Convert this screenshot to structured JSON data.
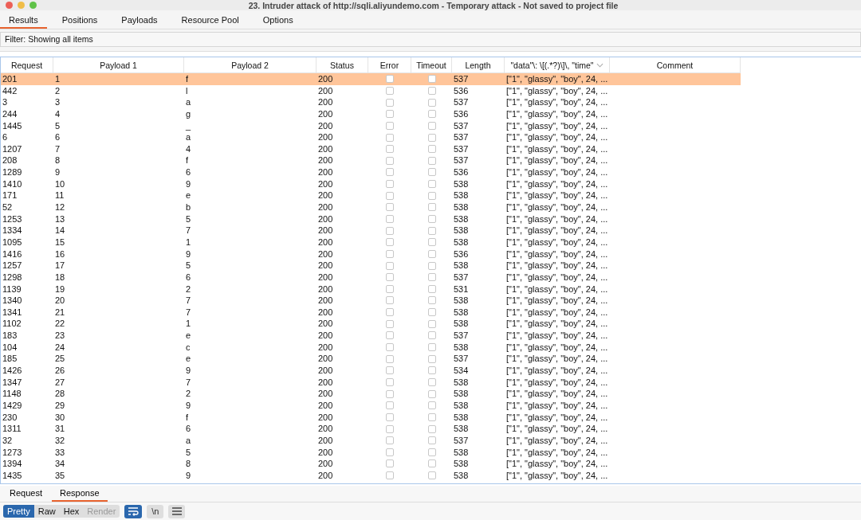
{
  "window": {
    "title": "23. Intruder attack of http://sqli.aliyundemo.com - Temporary attack - Not saved to project file"
  },
  "tabs": [
    {
      "label": "Results",
      "selected": true
    },
    {
      "label": "Positions",
      "selected": false
    },
    {
      "label": "Payloads",
      "selected": false
    },
    {
      "label": "Resource Pool",
      "selected": false
    },
    {
      "label": "Options",
      "selected": false
    }
  ],
  "filter": "Filter: Showing all items",
  "table": {
    "columns": [
      "Request",
      "Payload 1",
      "Payload 2",
      "Status",
      "Error",
      "Timeout",
      "Length",
      "\"data\"\\: \\[(.*?)\\]\\, \"time\"",
      "Comment"
    ],
    "rows": [
      {
        "request": "201",
        "payload1": "1",
        "payload2": "f",
        "status": "200",
        "error": false,
        "timeout": false,
        "length": "537",
        "extract": "[\"1\", \"glassy\", \"boy\", 24, ...",
        "selected": true
      },
      {
        "request": "442",
        "payload1": "2",
        "payload2": "l",
        "status": "200",
        "error": false,
        "timeout": false,
        "length": "536",
        "extract": "[\"1\", \"glassy\", \"boy\", 24, ...",
        "selected": false
      },
      {
        "request": "3",
        "payload1": "3",
        "payload2": "a",
        "status": "200",
        "error": false,
        "timeout": false,
        "length": "537",
        "extract": "[\"1\", \"glassy\", \"boy\", 24, ...",
        "selected": false
      },
      {
        "request": "244",
        "payload1": "4",
        "payload2": "g",
        "status": "200",
        "error": false,
        "timeout": false,
        "length": "536",
        "extract": "[\"1\", \"glassy\", \"boy\", 24, ...",
        "selected": false
      },
      {
        "request": "1445",
        "payload1": "5",
        "payload2": "_",
        "status": "200",
        "error": false,
        "timeout": false,
        "length": "537",
        "extract": "[\"1\", \"glassy\", \"boy\", 24, ...",
        "selected": false
      },
      {
        "request": "6",
        "payload1": "6",
        "payload2": "a",
        "status": "200",
        "error": false,
        "timeout": false,
        "length": "537",
        "extract": "[\"1\", \"glassy\", \"boy\", 24, ...",
        "selected": false
      },
      {
        "request": "1207",
        "payload1": "7",
        "payload2": "4",
        "status": "200",
        "error": false,
        "timeout": false,
        "length": "537",
        "extract": "[\"1\", \"glassy\", \"boy\", 24, ...",
        "selected": false
      },
      {
        "request": "208",
        "payload1": "8",
        "payload2": "f",
        "status": "200",
        "error": false,
        "timeout": false,
        "length": "537",
        "extract": "[\"1\", \"glassy\", \"boy\", 24, ...",
        "selected": false
      },
      {
        "request": "1289",
        "payload1": "9",
        "payload2": "6",
        "status": "200",
        "error": false,
        "timeout": false,
        "length": "536",
        "extract": "[\"1\", \"glassy\", \"boy\", 24, ...",
        "selected": false
      },
      {
        "request": "1410",
        "payload1": "10",
        "payload2": "9",
        "status": "200",
        "error": false,
        "timeout": false,
        "length": "538",
        "extract": "[\"1\", \"glassy\", \"boy\", 24, ...",
        "selected": false
      },
      {
        "request": "171",
        "payload1": "11",
        "payload2": "e",
        "status": "200",
        "error": false,
        "timeout": false,
        "length": "538",
        "extract": "[\"1\", \"glassy\", \"boy\", 24, ...",
        "selected": false
      },
      {
        "request": "52",
        "payload1": "12",
        "payload2": "b",
        "status": "200",
        "error": false,
        "timeout": false,
        "length": "538",
        "extract": "[\"1\", \"glassy\", \"boy\", 24, ...",
        "selected": false
      },
      {
        "request": "1253",
        "payload1": "13",
        "payload2": "5",
        "status": "200",
        "error": false,
        "timeout": false,
        "length": "538",
        "extract": "[\"1\", \"glassy\", \"boy\", 24, ...",
        "selected": false
      },
      {
        "request": "1334",
        "payload1": "14",
        "payload2": "7",
        "status": "200",
        "error": false,
        "timeout": false,
        "length": "538",
        "extract": "[\"1\", \"glassy\", \"boy\", 24, ...",
        "selected": false
      },
      {
        "request": "1095",
        "payload1": "15",
        "payload2": "1",
        "status": "200",
        "error": false,
        "timeout": false,
        "length": "538",
        "extract": "[\"1\", \"glassy\", \"boy\", 24, ...",
        "selected": false
      },
      {
        "request": "1416",
        "payload1": "16",
        "payload2": "9",
        "status": "200",
        "error": false,
        "timeout": false,
        "length": "536",
        "extract": "[\"1\", \"glassy\", \"boy\", 24, ...",
        "selected": false
      },
      {
        "request": "1257",
        "payload1": "17",
        "payload2": "5",
        "status": "200",
        "error": false,
        "timeout": false,
        "length": "538",
        "extract": "[\"1\", \"glassy\", \"boy\", 24, ...",
        "selected": false
      },
      {
        "request": "1298",
        "payload1": "18",
        "payload2": "6",
        "status": "200",
        "error": false,
        "timeout": false,
        "length": "537",
        "extract": "[\"1\", \"glassy\", \"boy\", 24, ...",
        "selected": false
      },
      {
        "request": "1139",
        "payload1": "19",
        "payload2": "2",
        "status": "200",
        "error": false,
        "timeout": false,
        "length": "531",
        "extract": "[\"1\", \"glassy\", \"boy\", 24, ...",
        "selected": false
      },
      {
        "request": "1340",
        "payload1": "20",
        "payload2": "7",
        "status": "200",
        "error": false,
        "timeout": false,
        "length": "538",
        "extract": "[\"1\", \"glassy\", \"boy\", 24, ...",
        "selected": false
      },
      {
        "request": "1341",
        "payload1": "21",
        "payload2": "7",
        "status": "200",
        "error": false,
        "timeout": false,
        "length": "538",
        "extract": "[\"1\", \"glassy\", \"boy\", 24, ...",
        "selected": false
      },
      {
        "request": "1102",
        "payload1": "22",
        "payload2": "1",
        "status": "200",
        "error": false,
        "timeout": false,
        "length": "538",
        "extract": "[\"1\", \"glassy\", \"boy\", 24, ...",
        "selected": false
      },
      {
        "request": "183",
        "payload1": "23",
        "payload2": "e",
        "status": "200",
        "error": false,
        "timeout": false,
        "length": "537",
        "extract": "[\"1\", \"glassy\", \"boy\", 24, ...",
        "selected": false
      },
      {
        "request": "104",
        "payload1": "24",
        "payload2": "c",
        "status": "200",
        "error": false,
        "timeout": false,
        "length": "538",
        "extract": "[\"1\", \"glassy\", \"boy\", 24, ...",
        "selected": false
      },
      {
        "request": "185",
        "payload1": "25",
        "payload2": "e",
        "status": "200",
        "error": false,
        "timeout": false,
        "length": "537",
        "extract": "[\"1\", \"glassy\", \"boy\", 24, ...",
        "selected": false
      },
      {
        "request": "1426",
        "payload1": "26",
        "payload2": "9",
        "status": "200",
        "error": false,
        "timeout": false,
        "length": "534",
        "extract": "[\"1\", \"glassy\", \"boy\", 24, ...",
        "selected": false
      },
      {
        "request": "1347",
        "payload1": "27",
        "payload2": "7",
        "status": "200",
        "error": false,
        "timeout": false,
        "length": "538",
        "extract": "[\"1\", \"glassy\", \"boy\", 24, ...",
        "selected": false
      },
      {
        "request": "1148",
        "payload1": "28",
        "payload2": "2",
        "status": "200",
        "error": false,
        "timeout": false,
        "length": "538",
        "extract": "[\"1\", \"glassy\", \"boy\", 24, ...",
        "selected": false
      },
      {
        "request": "1429",
        "payload1": "29",
        "payload2": "9",
        "status": "200",
        "error": false,
        "timeout": false,
        "length": "538",
        "extract": "[\"1\", \"glassy\", \"boy\", 24, ...",
        "selected": false
      },
      {
        "request": "230",
        "payload1": "30",
        "payload2": "f",
        "status": "200",
        "error": false,
        "timeout": false,
        "length": "538",
        "extract": "[\"1\", \"glassy\", \"boy\", 24, ...",
        "selected": false
      },
      {
        "request": "1311",
        "payload1": "31",
        "payload2": "6",
        "status": "200",
        "error": false,
        "timeout": false,
        "length": "538",
        "extract": "[\"1\", \"glassy\", \"boy\", 24, ...",
        "selected": false
      },
      {
        "request": "32",
        "payload1": "32",
        "payload2": "a",
        "status": "200",
        "error": false,
        "timeout": false,
        "length": "537",
        "extract": "[\"1\", \"glassy\", \"boy\", 24, ...",
        "selected": false
      },
      {
        "request": "1273",
        "payload1": "33",
        "payload2": "5",
        "status": "200",
        "error": false,
        "timeout": false,
        "length": "538",
        "extract": "[\"1\", \"glassy\", \"boy\", 24, ...",
        "selected": false
      },
      {
        "request": "1394",
        "payload1": "34",
        "payload2": "8",
        "status": "200",
        "error": false,
        "timeout": false,
        "length": "538",
        "extract": "[\"1\", \"glassy\", \"boy\", 24, ...",
        "selected": false
      },
      {
        "request": "1435",
        "payload1": "35",
        "payload2": "9",
        "status": "200",
        "error": false,
        "timeout": false,
        "length": "538",
        "extract": "[\"1\", \"glassy\", \"boy\", 24, ...",
        "selected": false
      }
    ]
  },
  "message_tabs": [
    {
      "label": "Request",
      "selected": false
    },
    {
      "label": "Response",
      "selected": true
    }
  ],
  "view_buttons": [
    {
      "label": "Pretty",
      "selected": true,
      "disabled": false
    },
    {
      "label": "Raw",
      "selected": false,
      "disabled": false
    },
    {
      "label": "Hex",
      "selected": false,
      "disabled": false
    },
    {
      "label": "Render",
      "selected": false,
      "disabled": true
    }
  ],
  "tools": [
    {
      "kind": "wrap",
      "on": true
    },
    {
      "kind": "newline",
      "label": "\\n",
      "on": false
    },
    {
      "kind": "menu",
      "on": false
    }
  ]
}
